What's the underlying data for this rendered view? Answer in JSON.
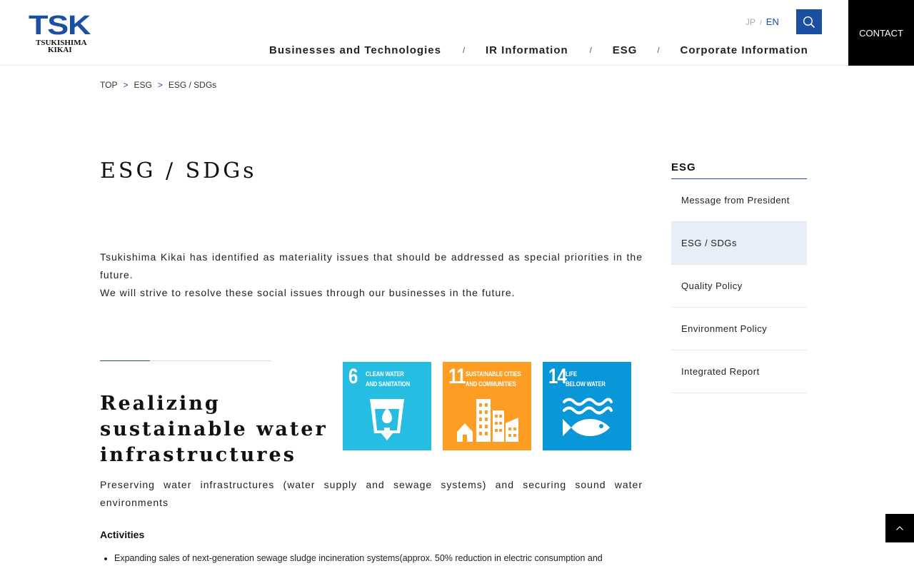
{
  "header": {
    "logo": {
      "mark": "TSK",
      "line1": "TSUKISHIMA",
      "line2": "KIKAI"
    },
    "lang": {
      "jp": "JP",
      "sep": "/",
      "en": "EN"
    },
    "search_icon": "search-icon",
    "contact_label": "CONTACT",
    "nav": [
      {
        "label": "Businesses and Technologies"
      },
      {
        "label": "IR Information"
      },
      {
        "label": "ESG"
      },
      {
        "label": "Corporate Information"
      }
    ],
    "nav_sep": "/"
  },
  "breadcrumb": {
    "items": [
      "TOP",
      "ESG",
      "ESG / SDGs"
    ],
    "sep": ">"
  },
  "main": {
    "title": "ESG / SDGs",
    "intro_line1": "Tsukishima Kikai has identified as materiality issues that should be addressed as special priorities in the future.",
    "intro_line2": "We will strive to resolve these social issues through our businesses in the future.",
    "section": {
      "title": "Realizing sustainable water infrastructures",
      "description": "Preserving water infrastructures (water supply and sewage systems) and securing sound water environments",
      "activities_heading": "Activities",
      "activities": [
        "Expanding sales of next-generation sewage sludge incineration systems(approx. 50% reduction in electric consumption and"
      ],
      "sdgs": [
        {
          "num": "6",
          "cap1": "CLEAN WATER",
          "cap2": "AND SANITATION",
          "color": "#26bde2"
        },
        {
          "num": "11",
          "cap1": "SUSTAINABLE CITIES",
          "cap2": "AND COMMUNITIES",
          "color": "#fd9d24"
        },
        {
          "num": "14",
          "cap1": "LIFE",
          "cap2": "BELOW WATER",
          "color": "#0a97d9"
        }
      ]
    }
  },
  "sidebar": {
    "title": "ESG",
    "items": [
      {
        "label": "Message from President"
      },
      {
        "label": "ESG / SDGs"
      },
      {
        "label": "Quality Policy"
      },
      {
        "label": "Environment Policy"
      },
      {
        "label": "Integrated Report"
      }
    ]
  },
  "colors": {
    "brand": "#1b4fa0",
    "active_bg": "#e8eef8"
  },
  "to_top_icon": "chevron-up-icon"
}
